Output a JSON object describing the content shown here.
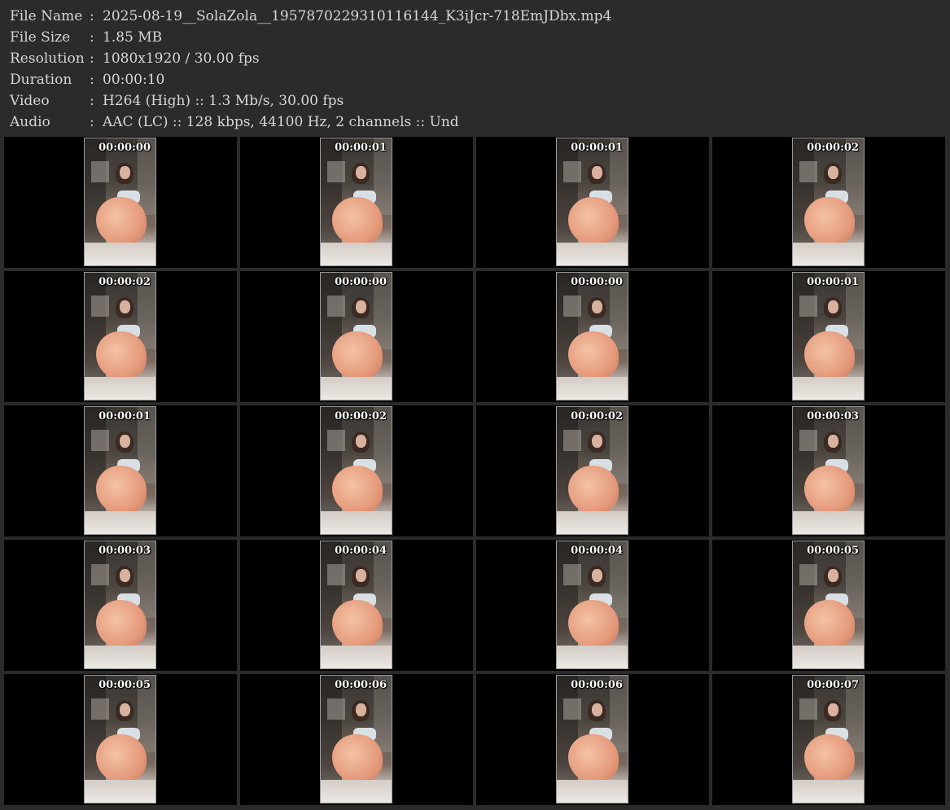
{
  "meta": {
    "file_name_label": "File Name",
    "file_name": "2025-08-19__SolaZola__1957870229310116144_K3iJcr-718EmJDbx.mp4",
    "file_size_label": "File Size",
    "file_size": "1.85 MB",
    "resolution_label": "Resolution",
    "resolution": "1080x1920 / 30.00 fps",
    "duration_label": "Duration",
    "duration": "00:00:10",
    "video_label": "Video",
    "video": "H264 (High) :: 1.3 Mb/s, 30.00 fps",
    "audio_label": "Audio",
    "audio": "AAC (LC) :: 128 kbps, 44100 Hz, 2 channels :: Und",
    "separator": ":"
  },
  "thumbnails": [
    "00:00:00",
    "00:00:01",
    "00:00:01",
    "00:00:02",
    "00:00:02",
    "00:00:00",
    "00:00:00",
    "00:00:01",
    "00:00:01",
    "00:00:02",
    "00:00:02",
    "00:00:03",
    "00:00:03",
    "00:00:04",
    "00:00:04",
    "00:00:05",
    "00:00:05",
    "00:00:06",
    "00:00:06",
    "00:00:07"
  ]
}
